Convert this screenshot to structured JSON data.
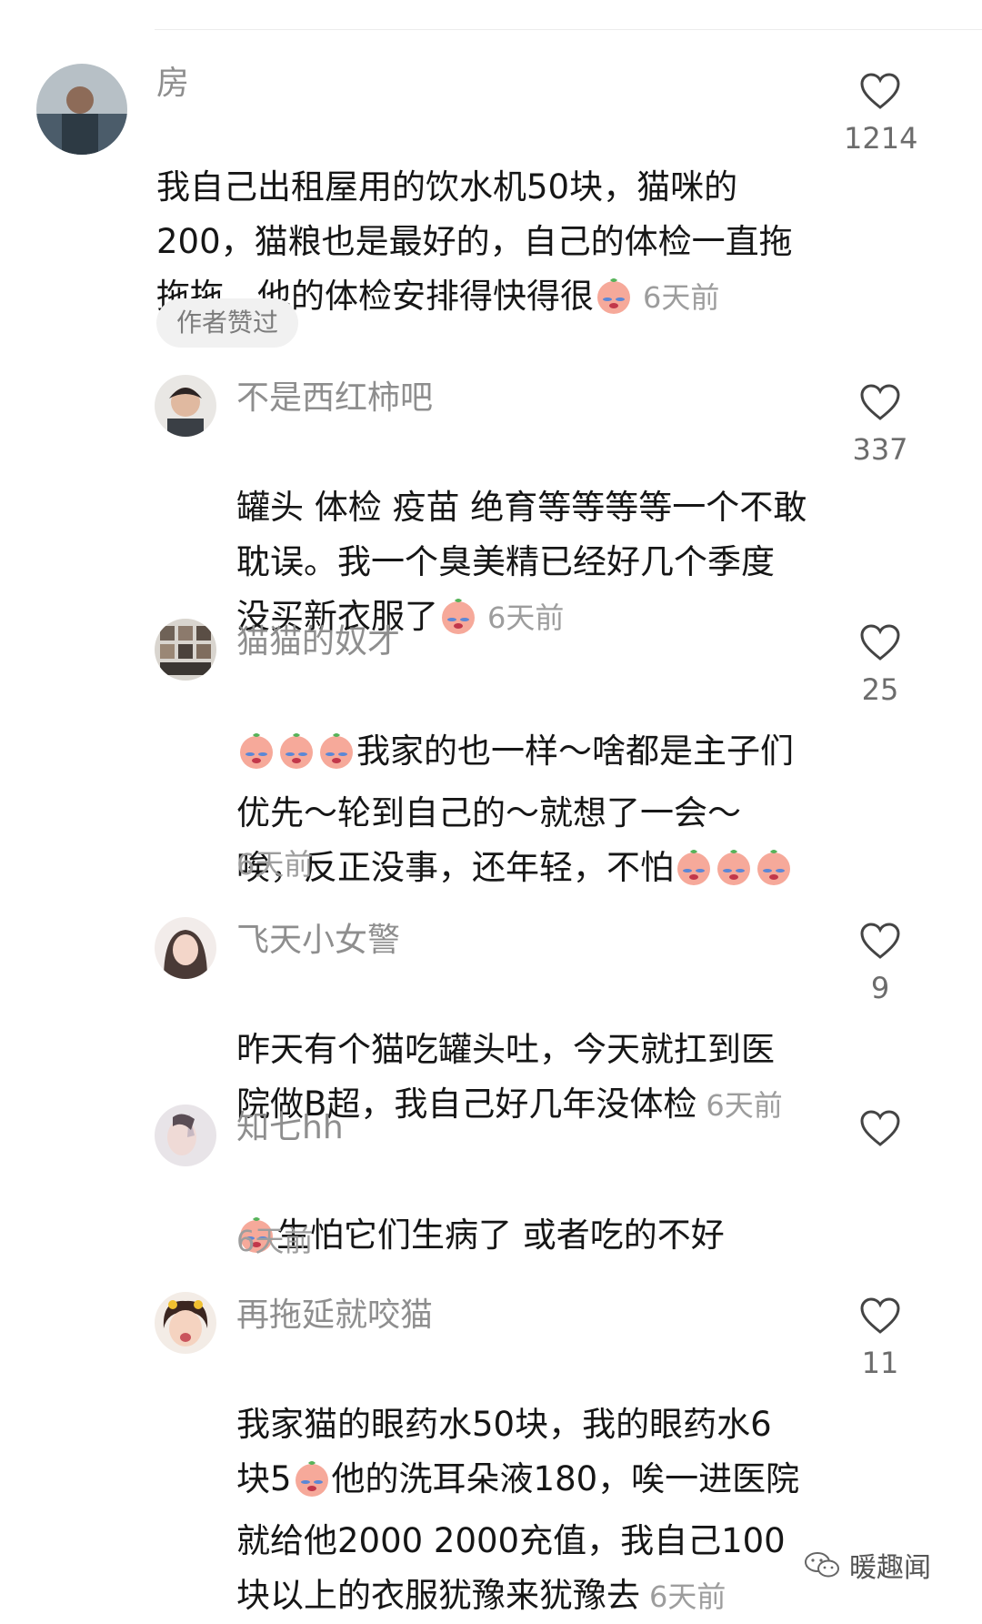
{
  "divider": true,
  "comments": [
    {
      "username": "房",
      "text": "我自己出租屋用的饮水机50块，猫咪的\n200，猫粮也是最好的，自己的体检一直拖\n拖拖，他的体检安排得快得很",
      "time": "6天前",
      "likes": "1214",
      "badge": "作者赞过",
      "emoji_after": [
        "sad-emoji"
      ]
    },
    {
      "username": "不是西红柿吧",
      "text": "罐头 体检 疫苗 绝育等等等等一个不敢\n耽误。我一个臭美精已经好几个季度\n没买新衣服了",
      "time": "6天前",
      "likes": "337",
      "emoji_after": [
        "sad-emoji"
      ]
    },
    {
      "username": "猫猫的奴才",
      "text_lead_emoji": 3,
      "text": "我家的也一样～啥都是主子们\n优先～轮到自己的～就想了一会～\n唉，反正没事，还年轻，不怕",
      "time": "6天前",
      "likes": "25",
      "emoji_after_count": 3
    },
    {
      "username": "飞天小女警",
      "text": "昨天有个猫吃罐头吐，今天就扛到医\n院做B超，我自己好几年没体检",
      "time": "6天前",
      "likes": "9"
    },
    {
      "username": "知七hh",
      "text_lead_emoji": 1,
      "text": "生怕它们生病了 或者吃的不好",
      "time": "6天前",
      "likes": ""
    },
    {
      "username": "再拖延就咬猫",
      "text_part1": "我家猫的眼药水50块，我的眼药水6\n块5",
      "text_part2": "他的洗耳朵液180，唉一进医院\n就给他2000 2000充值，我自己100\n块以上的衣服犹豫来犹豫去",
      "time": "6天前",
      "likes": "11"
    }
  ],
  "watermark": {
    "text": "暖趣闻",
    "icon": "wechat-icon"
  }
}
